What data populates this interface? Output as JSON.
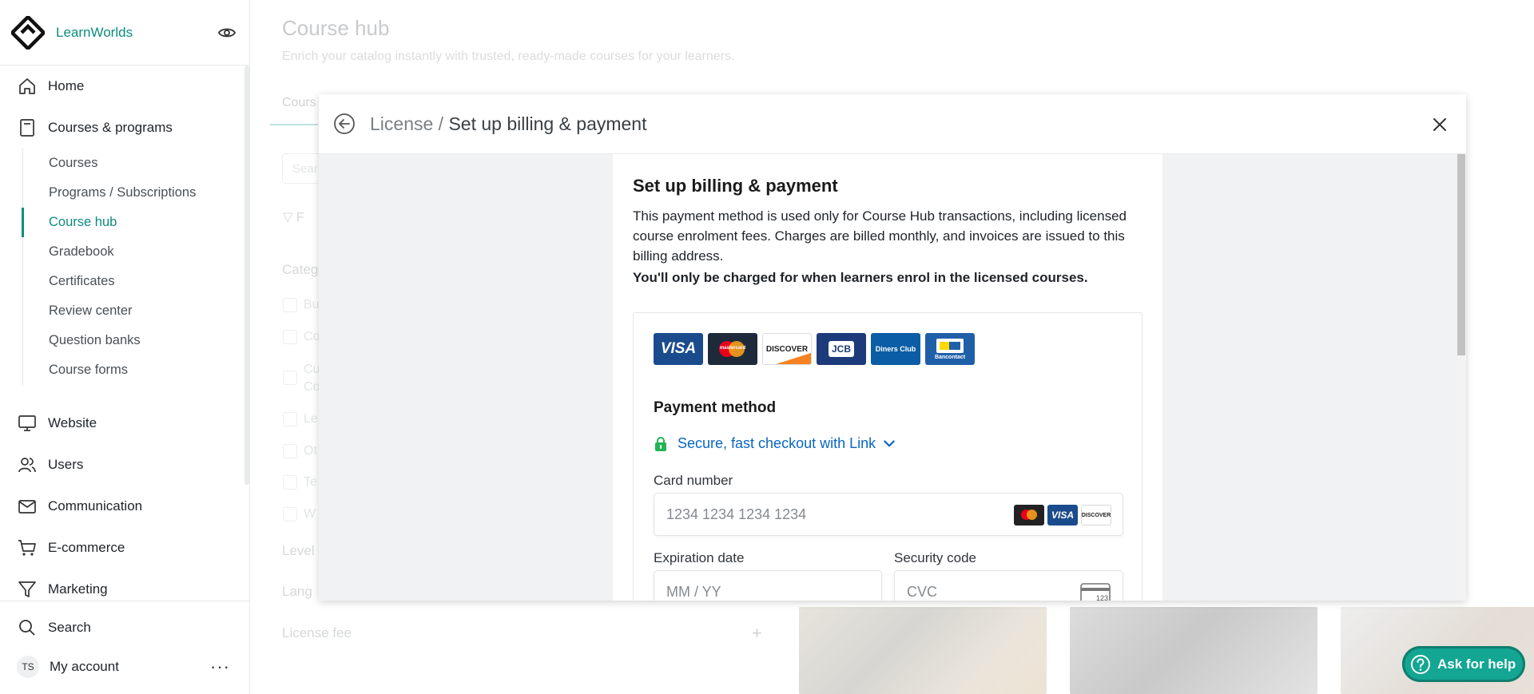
{
  "app": {
    "brand": "LearnWorlds"
  },
  "sidebar": {
    "items": [
      {
        "label": "Home",
        "icon": "home-icon"
      },
      {
        "label": "Courses & programs",
        "icon": "book-icon"
      }
    ],
    "sub_items": [
      {
        "label": "Courses"
      },
      {
        "label": "Programs / Subscriptions"
      },
      {
        "label": "Course hub",
        "active": true
      },
      {
        "label": "Gradebook"
      },
      {
        "label": "Certificates"
      },
      {
        "label": "Review center"
      },
      {
        "label": "Question banks"
      },
      {
        "label": "Course forms"
      }
    ],
    "items_after": [
      {
        "label": "Website",
        "icon": "monitor-icon"
      },
      {
        "label": "Users",
        "icon": "users-icon"
      },
      {
        "label": "Communication",
        "icon": "mail-icon"
      },
      {
        "label": "E-commerce",
        "icon": "cart-icon"
      },
      {
        "label": "Marketing",
        "icon": "funnel-icon"
      }
    ],
    "search_label": "Search",
    "account_label": "My account",
    "avatar_initials": "TS",
    "more_label": "···"
  },
  "main": {
    "title": "Course hub",
    "subtitle": "Enrich your catalog instantly with trusted, ready-made courses for your learners.",
    "tab": "Cours",
    "search_placeholder": "Sear",
    "filter_label": "F",
    "category_label": "Categ",
    "category_items": [
      "Bu",
      "Co",
      "Cu",
      "Co",
      "Le",
      "Ot",
      "Te",
      "W"
    ],
    "level_label": "Level",
    "language_label": "Lang",
    "license_fee_label": "License fee",
    "plus_label": "+"
  },
  "help": {
    "label": "Ask for help"
  },
  "modal": {
    "breadcrumb_parent": "License / ",
    "breadcrumb_current": "Set up billing & payment",
    "heading": "Set up billing & payment",
    "description": "This payment method is used only for Course Hub transactions, including licensed course enrolment fees. Charges are billed monthly, and invoices are issued to this billing address.",
    "notice": "You'll only be charged for when learners enrol in the licensed courses.",
    "card_brands": [
      "VISA",
      "mastercard",
      "DISCOVER",
      "JCB",
      "Diners Club",
      "Bancontact"
    ],
    "payment_method_title": "Payment method",
    "link_checkout": "Secure, fast checkout with Link",
    "card_number_label": "Card number",
    "card_number_placeholder": "1234 1234 1234 1234",
    "expiration_label": "Expiration date",
    "expiration_placeholder": "MM / YY",
    "security_label": "Security code",
    "security_placeholder": "CVC",
    "cvc_hint": "123"
  },
  "colors": {
    "accent": "#0d8c7e",
    "link": "#0a66c2",
    "help_button": "#13a692"
  }
}
